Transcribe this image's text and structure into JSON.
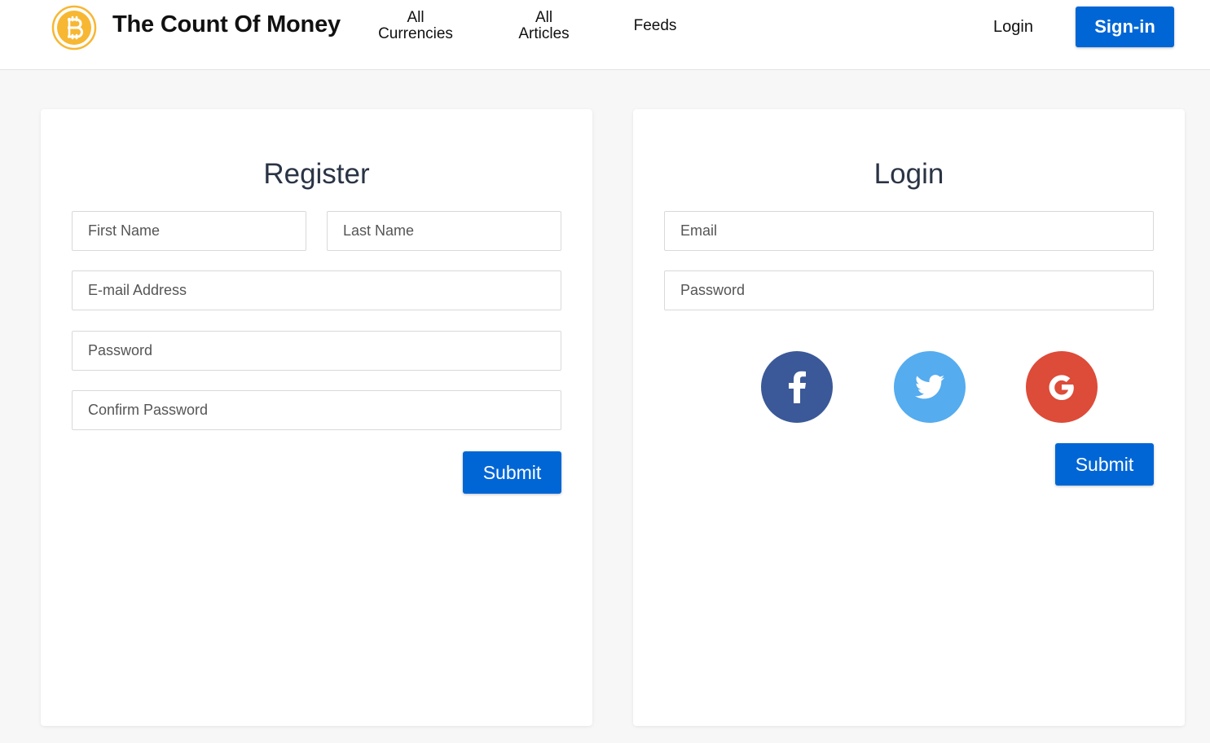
{
  "header": {
    "brand": "The Count Of Money",
    "nav": [
      {
        "line1": "All",
        "line2": "Currencies"
      },
      {
        "line1": "All",
        "line2": "Articles"
      },
      {
        "line1": "Feeds"
      }
    ],
    "login_label": "Login",
    "signin_label": "Sign-in"
  },
  "register": {
    "title": "Register",
    "first_name_placeholder": "First Name",
    "last_name_placeholder": "Last Name",
    "email_placeholder": "E-mail Address",
    "password_placeholder": "Password",
    "confirm_password_placeholder": "Confirm Password",
    "submit_label": "Submit"
  },
  "login": {
    "title": "Login",
    "email_placeholder": "Email",
    "password_placeholder": "Password",
    "social": [
      {
        "icon": "facebook-icon",
        "color": "#3b5998"
      },
      {
        "icon": "twitter-icon",
        "color": "#55acee"
      },
      {
        "icon": "google-icon",
        "color": "#dd4b39"
      }
    ],
    "submit_label": "Submit"
  },
  "colors": {
    "accent": "#0066d6",
    "logo": "#f7b733"
  }
}
